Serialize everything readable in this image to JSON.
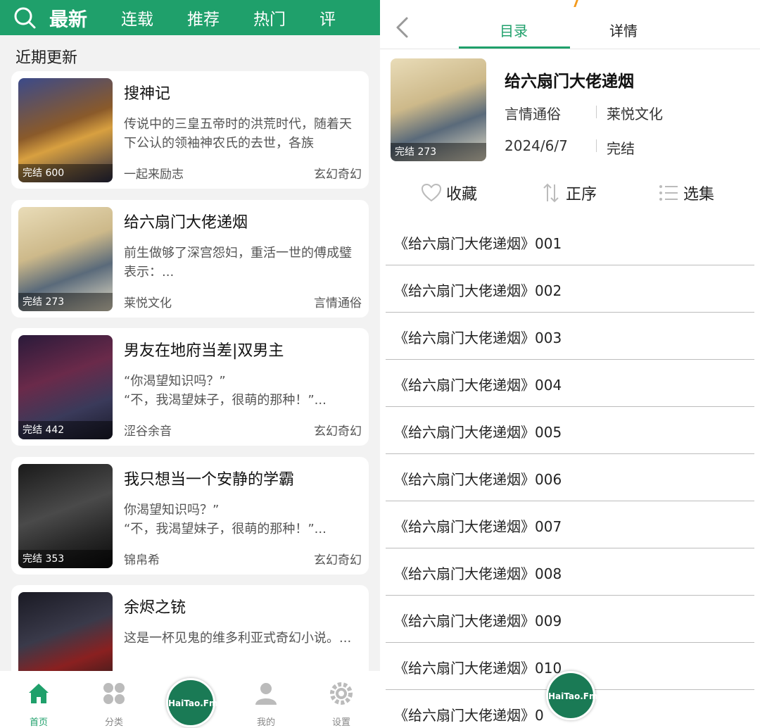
{
  "left": {
    "categories": [
      "最新",
      "连载",
      "推荐",
      "热门",
      "评"
    ],
    "section_title": "近期更新",
    "books": [
      {
        "title": "搜神记",
        "desc": "传说中的三皇五帝时的洪荒时代，随着天下公认的领袖神农氏的去世，各族",
        "author": "一起来励志",
        "genre": "玄幻奇幻",
        "badge": "完结 600"
      },
      {
        "title": "给六扇门大佬递烟",
        "desc": "前生做够了深宫怨妇，重活一世的傅成璧表示：...",
        "author": "莱悦文化",
        "genre": "言情通俗",
        "badge": "完结 273"
      },
      {
        "title": "男友在地府当差|双男主",
        "desc": "“你渴望知识吗？”\n“不，我渴望妹子，很萌的那种！”...",
        "author": "涩谷余音",
        "genre": "玄幻奇幻",
        "badge": "完结 442"
      },
      {
        "title": "我只想当一个安静的学霸",
        "desc": "你渴望知识吗？”\n“不，我渴望妹子，很萌的那种！”...",
        "author": "锦帛希",
        "genre": "玄幻奇幻",
        "badge": "完结 353"
      },
      {
        "title": "余烬之铳",
        "desc": "这是一杯见鬼的维多利亚式奇幻小说。...",
        "author": "",
        "genre": "",
        "badge": ""
      }
    ],
    "nav": {
      "home": "首页",
      "category": "分类",
      "player": "HaiTao.Fm",
      "me": "我的",
      "settings": "设置"
    }
  },
  "right": {
    "tabs": {
      "toc": "目录",
      "detail": "详情"
    },
    "book": {
      "title": "给六扇门大佬递烟",
      "genre": "言情通俗",
      "publisher": "莱悦文化",
      "date": "2024/6/7",
      "status": "完结",
      "badge": "完结 273"
    },
    "actions": {
      "favorite": "收藏",
      "order": "正序",
      "select": "选集"
    },
    "episodes": [
      "《给六扇门大佬递烟》001",
      "《给六扇门大佬递烟》002",
      "《给六扇门大佬递烟》003",
      "《给六扇门大佬递烟》004",
      "《给六扇门大佬递烟》005",
      "《给六扇门大佬递烟》006",
      "《给六扇门大佬递烟》007",
      "《给六扇门大佬递烟》008",
      "《给六扇门大佬递烟》009",
      "《给六扇门大佬递烟》010",
      "《给六扇门大佬递烟》0"
    ],
    "player": "HaiTao.Fm"
  },
  "colors": {
    "accent": "#1fa06b",
    "fab": "#1a7a55",
    "orange": "#f39a1d"
  }
}
